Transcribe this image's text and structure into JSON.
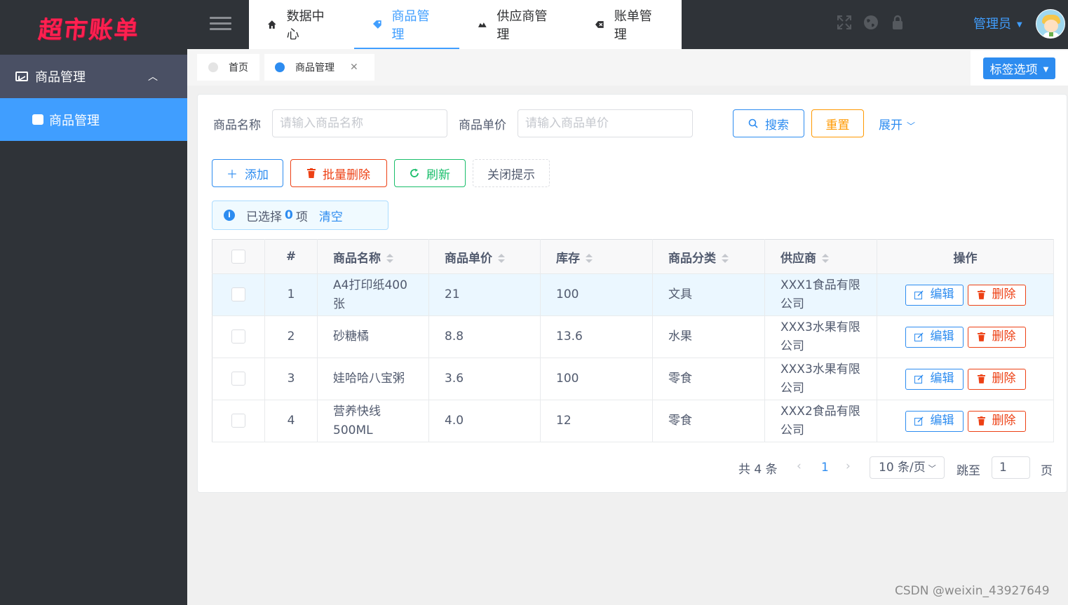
{
  "app": {
    "logo": "超市账单",
    "watermark": "CSDN @weixin_43927649"
  },
  "sidebar": {
    "group": {
      "label": "商品管理",
      "chevron": "chevron-up-icon"
    },
    "items": [
      {
        "label": "商品管理",
        "active": true
      }
    ]
  },
  "topnav": {
    "tabs": [
      {
        "label": "数据中心",
        "icon": "home-icon"
      },
      {
        "label": "商品管理",
        "icon": "tag-icon",
        "active": true
      },
      {
        "label": "供应商管理",
        "icon": "truck-icon"
      },
      {
        "label": "账单管理",
        "icon": "backspace-icon"
      }
    ],
    "user": "管理员"
  },
  "tabbar": {
    "tabs": [
      {
        "label": "首页"
      },
      {
        "label": "商品管理",
        "active": true
      }
    ],
    "options_label": "标签选项"
  },
  "search": {
    "name_label": "商品名称",
    "name_placeholder": "请输入商品名称",
    "price_label": "商品单价",
    "price_placeholder": "请输入商品单价",
    "search_label": "搜索",
    "reset_label": "重置",
    "expand_label": "展开"
  },
  "toolbar": {
    "add_label": "添加",
    "batch_delete_label": "批量删除",
    "refresh_label": "刷新",
    "close_tip_label": "关闭提示"
  },
  "alert": {
    "prefix": "已选择",
    "count": "0",
    "suffix": "项",
    "clear": "清空"
  },
  "table": {
    "columns": [
      "#",
      "商品名称",
      "商品单价",
      "库存",
      "商品分类",
      "供应商",
      "操作"
    ],
    "rows": [
      {
        "idx": "1",
        "name": "A4打印纸400张",
        "price": "21",
        "stock": "100",
        "category": "文具",
        "supplier": "XXX1食品有限公司"
      },
      {
        "idx": "2",
        "name": "砂糖橘",
        "price": "8.8",
        "stock": "13.6",
        "category": "水果",
        "supplier": "XXX3水果有限公司"
      },
      {
        "idx": "3",
        "name": "娃哈哈八宝粥",
        "price": "3.6",
        "stock": "100",
        "category": "零食",
        "supplier": "XXX3水果有限公司"
      },
      {
        "idx": "4",
        "name": "营养快线500ML",
        "price": "4.0",
        "stock": "12",
        "category": "零食",
        "supplier": "XXX2食品有限公司"
      }
    ],
    "edit_label": "编辑",
    "delete_label": "删除"
  },
  "pagination": {
    "total": "共 4 条",
    "current": "1",
    "page_size": "10 条/页",
    "jump_label": "跳至",
    "jump_value": "1",
    "page_unit": "页"
  }
}
